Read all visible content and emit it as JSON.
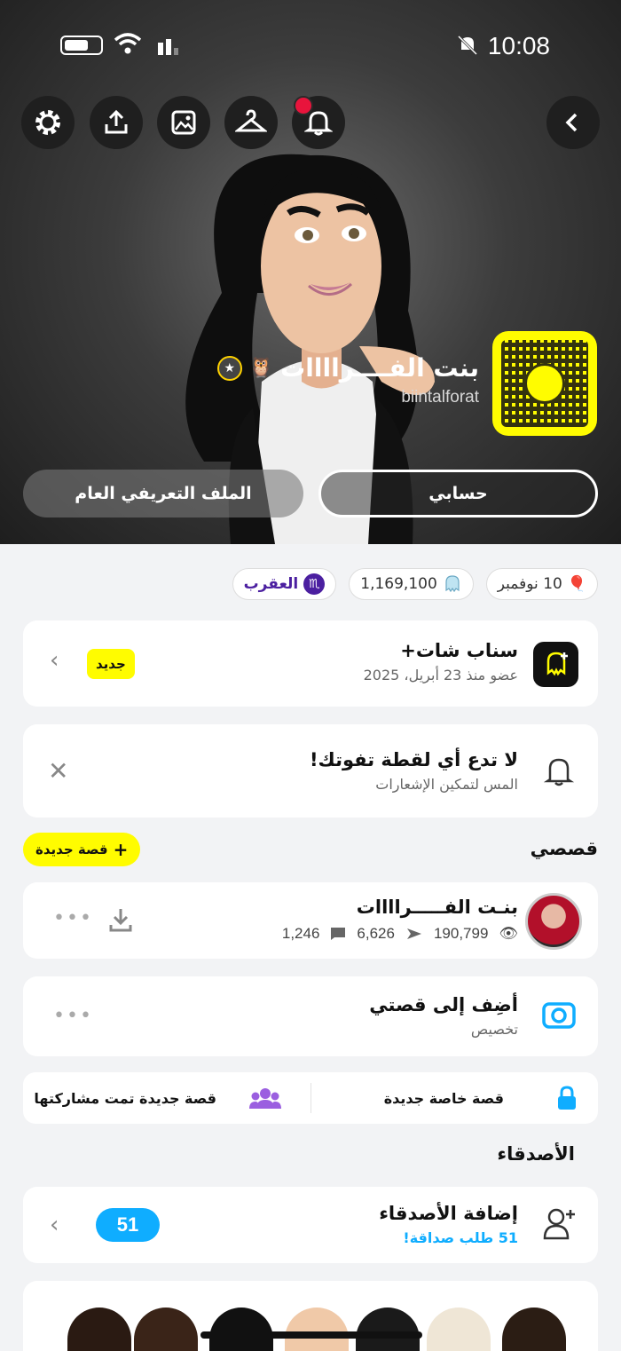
{
  "status_bar": {
    "time": "10:08"
  },
  "profile": {
    "display_name": "بنت الفــــراااات",
    "username": "biintalforat",
    "button_account": "حسابي",
    "button_public_profile": "الملف التعريفي العام"
  },
  "pills": [
    {
      "text": "10 نوفمبر",
      "icon": "balloon-icon"
    },
    {
      "text": "1,169,100",
      "icon": "ghost-score-icon"
    },
    {
      "text": "العقرب",
      "icon": "scorpio-icon",
      "glyph": "♏"
    }
  ],
  "snapchat_plus": {
    "title": "سناب شات+",
    "subtitle": "عضو منذ 23 أبريل، 2025",
    "badge": "جديد"
  },
  "notifications_card": {
    "title": "لا تدع أي لقطة تفوتك!",
    "subtitle": "المس لتمكين الإشعارات"
  },
  "stories": {
    "section_title": "قصصي",
    "new_story_label": "قصة جديدة",
    "my_story": {
      "name": "بنـت الفـــــراااات",
      "views": "190,799",
      "screenshots": "6,626",
      "replies": "1,246"
    },
    "add_story": {
      "title": "أضِف إلى قصتي",
      "subtitle": "تخصيص"
    },
    "private_story_label": "قصة خاصة جديدة",
    "shared_story_label": "قصة جديدة تمت مشاركتها"
  },
  "friends": {
    "section_title": "الأصدقاء",
    "add_friends_title": "إضافة الأصدقاء",
    "requests_text": "51 طلب صداقة!",
    "count": "51"
  },
  "colors": {
    "snap_yellow": "#fffc00",
    "blue": "#0fadff",
    "notification_red": "#e8143c"
  }
}
